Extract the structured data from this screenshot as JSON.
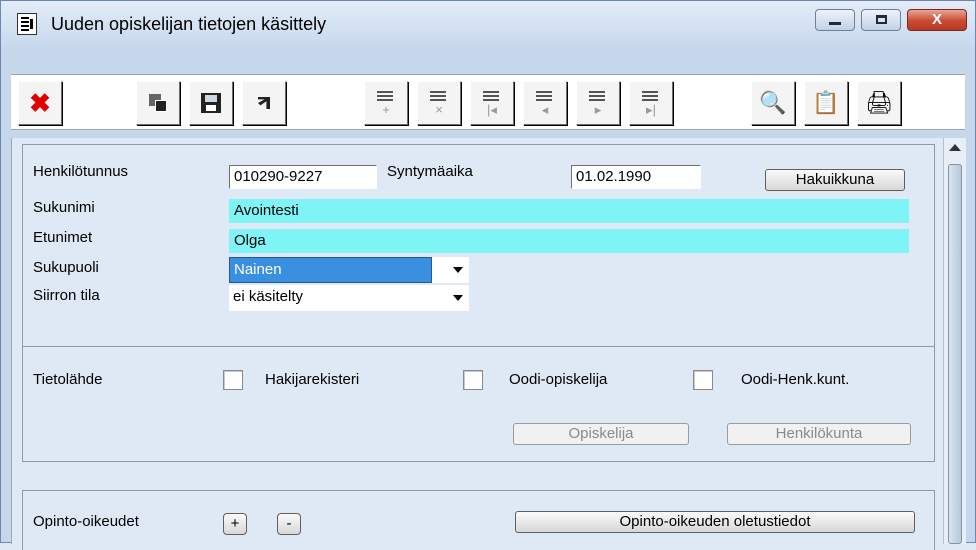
{
  "window": {
    "title": "Uuden opiskelijan tietojen käsittely",
    "close_glyph": "X"
  },
  "toolbar": {
    "icons": [
      "close-icon",
      "copy-icon",
      "save-icon",
      "return-icon",
      "add-row-icon",
      "delete-row-icon",
      "first-record-icon",
      "previous-record-icon",
      "next-record-icon",
      "last-record-icon",
      "search-icon",
      "document-icon",
      "print-icon"
    ],
    "sub_glyphs": {
      "add": "+",
      "delete": "×",
      "first": "|◂",
      "previous": "◂",
      "next": "▸",
      "last": "▸|"
    }
  },
  "form": {
    "henkilotunnus_label": "Henkilötunnus",
    "henkilotunnus_value": "010290-9227",
    "syntymaaika_label": "Syntymäaika",
    "syntymaaika_value": "01.02.1990",
    "hakuikkuna_button": "Hakuikkuna",
    "sukunimi_label": "Sukunimi",
    "sukunimi_value": "Avointesti",
    "etunimet_label": "Etunimet",
    "etunimet_value": "Olga",
    "sukupuoli_label": "Sukupuoli",
    "sukupuoli_value": "Nainen",
    "siirron_tila_label": "Siirron tila",
    "siirron_tila_value": "ei käsitelty"
  },
  "source": {
    "label": "Tietolähde",
    "options": [
      {
        "label": "Hakijarekisteri",
        "checked": false
      },
      {
        "label": "Oodi-opiskelija",
        "checked": false
      },
      {
        "label": "Oodi-Henk.kunt.",
        "checked": false
      }
    ],
    "opiskelija_button": "Opiskelija",
    "henkilokunta_button": "Henkilökunta"
  },
  "rights": {
    "label": "Opinto-oikeudet",
    "add_button": "+",
    "remove_button": "-",
    "defaults_button": "Opinto-oikeuden oletustiedot"
  }
}
